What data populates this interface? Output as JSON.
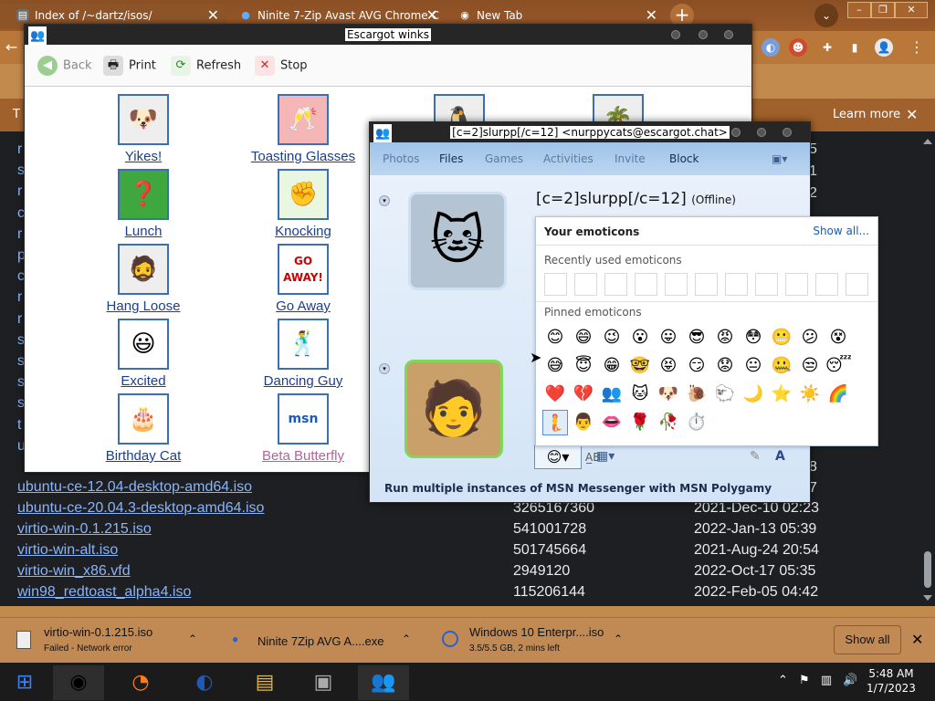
{
  "browser": {
    "tabs": [
      {
        "label": "Index of /~dartz/isos/",
        "icon": "folder-icon"
      },
      {
        "label": "Ninite 7-Zip Avast AVG Chrome C",
        "icon": "ninite-icon"
      },
      {
        "label": "New Tab",
        "icon": "chrome-icon"
      }
    ],
    "infobar_text": "T",
    "infobar_button": "Learn more"
  },
  "listing": {
    "rows": [
      {
        "name": "ubuntu-ce-12.04-desktop-amd64.iso",
        "size": "",
        "date": ""
      },
      {
        "name": "ubuntu-ce-20.04.3-desktop-amd64.iso",
        "size": "3265167360",
        "date": "2021-Dec-10 02:23"
      },
      {
        "name": "virtio-win-0.1.215.iso",
        "size": "541001728",
        "date": "2022-Jan-13 05:39"
      },
      {
        "name": "virtio-win-alt.iso",
        "size": "501745664",
        "date": "2021-Aug-24 20:54"
      },
      {
        "name": "virtio-win_x86.vfd",
        "size": "2949120",
        "date": "2022-Oct-17 05:35"
      },
      {
        "name": "win98_redtoast_alpha4.iso",
        "size": "115206144",
        "date": "2022-Feb-05 04:42"
      }
    ],
    "edge_numbers": [
      "5",
      "1",
      "2",
      "8",
      "7"
    ]
  },
  "winks_window": {
    "title": "Escargot winks",
    "toolbar": {
      "back": "Back",
      "print": "Print",
      "refresh": "Refresh",
      "stop": "Stop"
    },
    "items": [
      {
        "label": "Yikes!",
        "icon": "dog-face-icon"
      },
      {
        "label": "Toasting Glasses",
        "icon": "glasses-icon"
      },
      {
        "label": "Lunch",
        "icon": "lunch-icon"
      },
      {
        "label": "Knocking",
        "icon": "knocking-icon"
      },
      {
        "label": "Hang Loose",
        "icon": "person-icon"
      },
      {
        "label": "Go Away",
        "icon": "go-away-sign-icon"
      },
      {
        "label": "Excited",
        "icon": "smiley-icon"
      },
      {
        "label": "Dancing Guy",
        "icon": "dancing-guy-icon"
      },
      {
        "label": "Birthday Cat",
        "icon": "cat-cake-icon"
      },
      {
        "label": "Beta Butterfly",
        "icon": "msn-butterfly-icon"
      }
    ],
    "go_away_text": "GO AWAY!",
    "msn_logo_text": "msn"
  },
  "msn_window": {
    "title": "[c=2]slurpp[/c=12] <nurppycats@escargot.chat>",
    "menu": [
      "Photos",
      "Files",
      "Games",
      "Activities",
      "Invite",
      "Block"
    ],
    "contact_name": "[c=2]slurpp[/c=12]",
    "contact_status": "(Offline)",
    "footer_text": "Run multiple instances of MSN Messenger with MSN Polygamy"
  },
  "emoticons": {
    "header": "Your emoticons",
    "show_all": "Show all...",
    "recent_label": "Recently used emoticons",
    "pinned_label": "Pinned emoticons",
    "pinned": [
      "😊",
      "😄",
      "😉",
      "😮",
      "😛",
      "😎",
      "😡",
      "😳",
      "😬",
      "😕",
      "😵",
      "😅",
      "😇",
      "😁",
      "🤓",
      "😝",
      "😏",
      "😟",
      "😐",
      "🤐",
      "😒",
      "😴",
      "❤️",
      "💔",
      "👥",
      "🐱",
      "🐶",
      "🐌",
      "🐑",
      "🌙",
      "⭐",
      "☀️",
      "🌈",
      "🧜",
      "👨",
      "👄",
      "🌹",
      "🥀",
      "⏱️"
    ]
  },
  "downloads": [
    {
      "name": "virtio-win-0.1.215.iso",
      "status": "Failed - Network error"
    },
    {
      "name": "Ninite 7Zip AVG A....exe",
      "status": ""
    },
    {
      "name": "Windows 10 Enterpr....iso",
      "status": "3.5/5.5 GB, 2 mins left"
    }
  ],
  "downloads_show_all": "Show all",
  "taskbar": {
    "time": "5:48 AM",
    "date": "1/7/2023"
  }
}
